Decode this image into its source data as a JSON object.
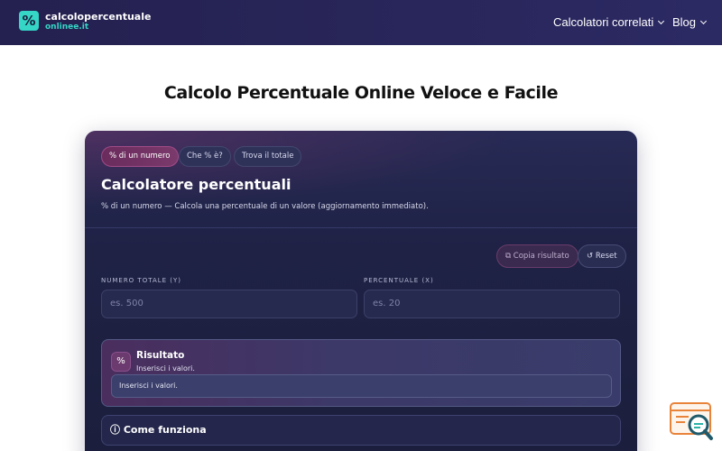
{
  "header": {
    "logo_glyph": "%",
    "brand_line1": "calcolopercentuale",
    "brand_line2": "onlinee.it",
    "nav": [
      {
        "label": "Calcolatori correlati"
      },
      {
        "label": "Blog"
      }
    ]
  },
  "page": {
    "title": "Calcolo Percentuale Online Veloce e Facile"
  },
  "calculator": {
    "tabs": [
      {
        "label": "% di un numero",
        "active": true
      },
      {
        "label": "Che % è?",
        "active": false
      },
      {
        "label": "Trova il totale",
        "active": false
      }
    ],
    "title": "Calcolatore percentuali",
    "description": "% di un numero — Calcola una percentuale di un valore (aggiornamento immediato).",
    "copy_button": "Copia risultato",
    "copy_icon": "copy-icon",
    "reset_button": "Reset",
    "reset_glyph": "↺",
    "fields": [
      {
        "label": "NUMERO TOTALE (Y)",
        "placeholder": "es. 500",
        "value": ""
      },
      {
        "label": "PERCENTUALE (X)",
        "placeholder": "es. 20",
        "value": ""
      }
    ],
    "result": {
      "title": "Risultato",
      "subtitle": "Inserisci i valori.",
      "box_text": "Inserisci i valori."
    },
    "howto_title": "Come funziona"
  },
  "colors": {
    "header_bg": "#24204f",
    "accent_teal": "#35d6c6",
    "card_bg": "#1f2245",
    "active_tab": "#7a3a6c"
  }
}
